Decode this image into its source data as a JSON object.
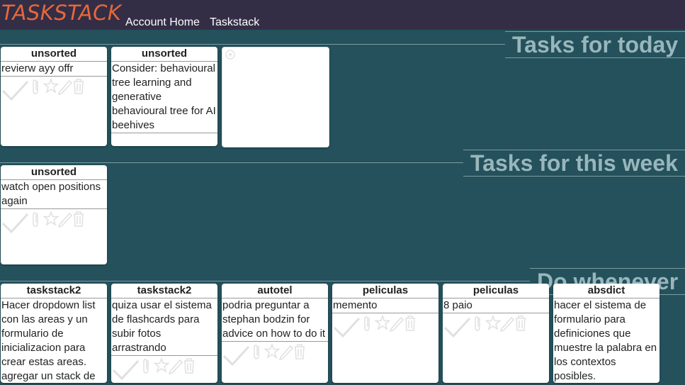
{
  "header": {
    "brand": "TASKSTACK",
    "nav": [
      "Account Home",
      "Taskstack"
    ]
  },
  "colors": {
    "topbar": "#332e46",
    "brand": "#e8673a",
    "background": "#24515b",
    "section_title": "#98b6bc"
  },
  "sections": {
    "today": {
      "title": "Tasks for today",
      "cards": [
        {
          "category": "unsorted",
          "text": "revierw ayy offr"
        },
        {
          "category": "unsorted",
          "text": "Consider: behavioural tree learning and generative behavioural tree for AI beehives"
        }
      ]
    },
    "week": {
      "title": "Tasks for this week",
      "cards": [
        {
          "category": "unsorted",
          "text": "watch open positions again"
        }
      ]
    },
    "whenever": {
      "title": "Do whenever",
      "cards": [
        {
          "category": "taskstack2",
          "text": "Hacer dropdown list con las areas y un formulario de inicializacion para crear estas areas. agregar un stack de"
        },
        {
          "category": "taskstack2",
          "text": "quiza usar el sistema de flashcards para subir fotos arrastrando"
        },
        {
          "category": "autotel",
          "text": "podria preguntar a stephan bodzin for advice on how to do it"
        },
        {
          "category": "peliculas",
          "text": "memento"
        },
        {
          "category": "peliculas",
          "text": "8 paio"
        },
        {
          "category": "absdict",
          "text": "hacer el sistema de formulario para definiciones que muestre la palabra en los contextos posibles."
        }
      ]
    }
  },
  "icons": [
    "check-icon",
    "paperclip-icon",
    "star-icon",
    "pencil-icon",
    "trash-icon",
    "add-circle-icon"
  ]
}
